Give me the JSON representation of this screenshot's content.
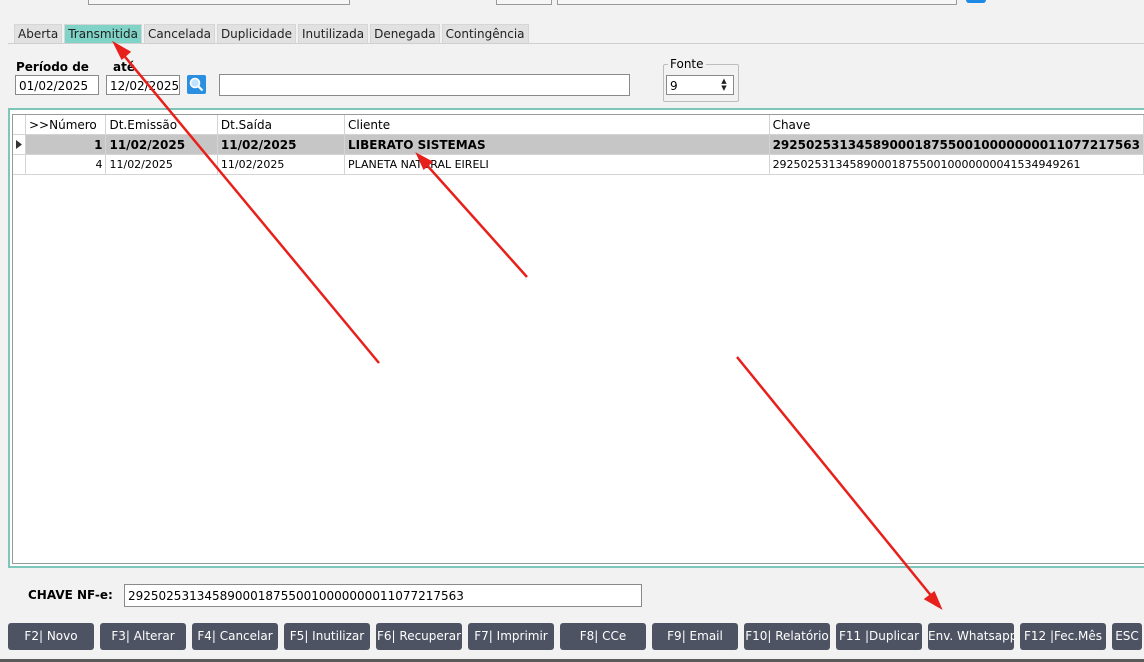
{
  "tabs": [
    "Aberta",
    "Transmitida",
    "Cancelada",
    "Duplicidade",
    "Inutilizada",
    "Denegada",
    "Contingência"
  ],
  "active_tab": "Transmitida",
  "filters": {
    "periodo_label": "Período de",
    "ate_label": "até",
    "date_from": "01/02/2025",
    "date_to": "12/02/2025",
    "search_value": "",
    "fonte_label": "Fonte",
    "fonte_value": "9"
  },
  "grid": {
    "columns": [
      ">>Número",
      "Dt.Emissão",
      "Dt.Saída",
      "Cliente",
      "Chave"
    ],
    "rows": [
      {
        "numero": "1",
        "emissao": "11/02/2025",
        "saida": "11/02/2025",
        "cliente": "LIBERATO SISTEMAS",
        "chave": "29250253134589000187550010000000011077217563",
        "selected": true
      },
      {
        "numero": "4",
        "emissao": "11/02/2025",
        "saida": "11/02/2025",
        "cliente": "PLANETA NATURAL EIRELI",
        "chave": "29250253134589000187550010000000041534949261",
        "selected": false
      }
    ]
  },
  "chave": {
    "label": "CHAVE NF-e:",
    "value": "29250253134589000187550010000000011077217563"
  },
  "buttons": [
    "F2| Novo",
    "F3| Alterar",
    "F4| Cancelar",
    "F5| Inutilizar",
    "F6| Recuperar",
    "F7| Imprimir",
    "F8| CCe",
    "F9| Email",
    "F10| Relatório",
    "F11 |Duplicar",
    "Env. Whatsapp",
    "F12 |Fec.Mês",
    "ESC"
  ],
  "colors": {
    "active_tab": "#7fd3c7",
    "selected_row": "#c6c6c6",
    "button_bg": "#4d5362",
    "arrow": "#e8201c",
    "grid_border": "#7dc6b9"
  },
  "icons": {
    "search": "magnifier-icon",
    "indicator": "row-pointer-icon"
  }
}
